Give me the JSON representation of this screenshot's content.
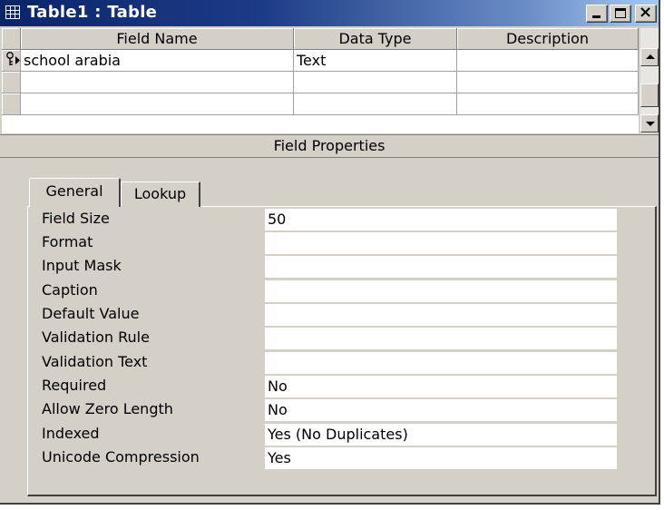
{
  "window": {
    "title": "Table1 : Table",
    "icon": "table-icon",
    "controls": [
      "minimize-icon",
      "maximize-icon",
      "close-icon"
    ]
  },
  "grid": {
    "columns": [
      "Field Name",
      "Data Type",
      "Description"
    ],
    "rows": [
      {
        "selector": "primary-key-current-row",
        "field_name": "school arabia",
        "data_type": "Text",
        "description": ""
      },
      {
        "selector": "",
        "field_name": "",
        "data_type": "",
        "description": ""
      },
      {
        "selector": "",
        "field_name": "",
        "data_type": "",
        "description": ""
      }
    ]
  },
  "field_properties": {
    "heading": "Field Properties",
    "tabs": [
      "General",
      "Lookup"
    ],
    "active_tab": "General",
    "properties": [
      {
        "label": "Field Size",
        "value": "50"
      },
      {
        "label": "Format",
        "value": ""
      },
      {
        "label": "Input Mask",
        "value": ""
      },
      {
        "label": "Caption",
        "value": ""
      },
      {
        "label": "Default Value",
        "value": ""
      },
      {
        "label": "Validation Rule",
        "value": ""
      },
      {
        "label": "Validation Text",
        "value": ""
      },
      {
        "label": "Required",
        "value": "No"
      },
      {
        "label": "Allow Zero Length",
        "value": "No"
      },
      {
        "label": "Indexed",
        "value": "Yes (No Duplicates)"
      },
      {
        "label": "Unicode Compression",
        "value": "Yes"
      }
    ]
  }
}
